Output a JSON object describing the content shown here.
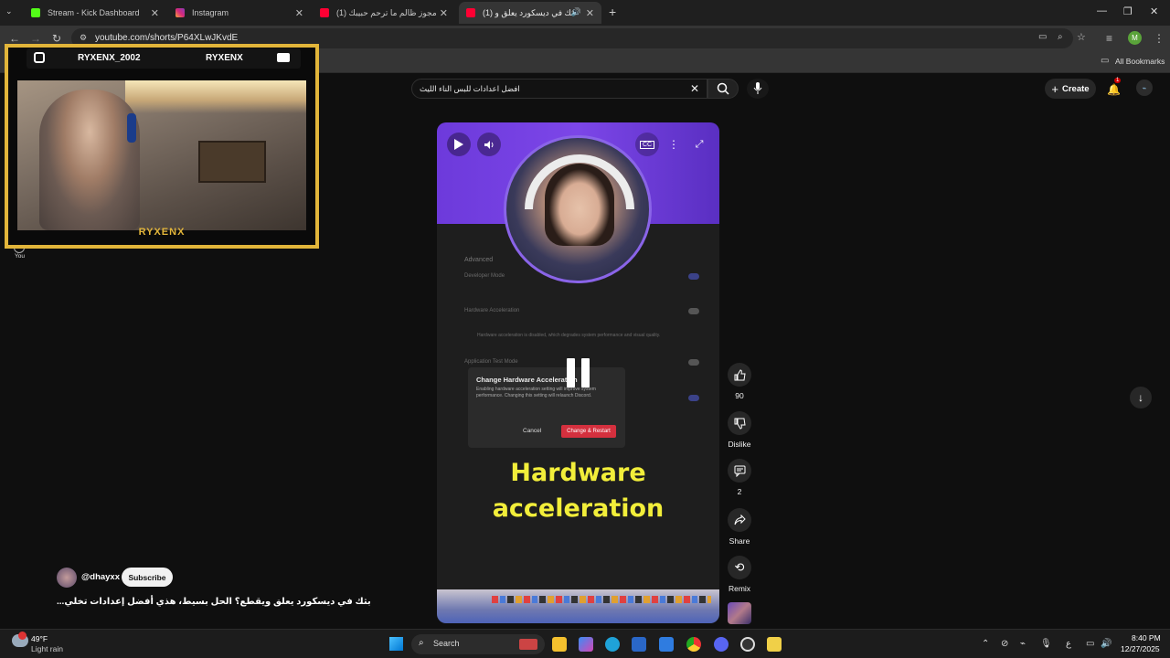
{
  "browser": {
    "tabs": [
      {
        "label": "Stream - Kick Dashboard",
        "active": false
      },
      {
        "label": "Instagram",
        "active": false
      },
      {
        "label": "(1) مجوز ظالم ما ترحم حبيبك / ...",
        "active": false
      },
      {
        "label": "(1) بثك في ديسكورد يعلق و...",
        "active": true
      }
    ],
    "url": "youtube.com/shorts/P64XLwJKvdE",
    "bookmarks_label": "All Bookmarks",
    "profile_initial": "M"
  },
  "youtube": {
    "search_value": "افضل اعدادات للبس الناء الليث",
    "create_label": "Create",
    "notification_count": "1"
  },
  "webcam_overlay": {
    "handle_left": "RYXENX_2002",
    "handle_right": "RYXENX",
    "name": "RYXENX"
  },
  "sidebar": {
    "you_label": "You"
  },
  "short": {
    "settings_heading": "Advanced",
    "settings_items": [
      "Developer Mode",
      "Hardware Acceleration",
      "Application Test Mode"
    ],
    "warning_text": "Hardware acceleration is disabled, which degrades system performance and visual quality.",
    "dialog_title": "Change Hardware Acceleration",
    "dialog_body": "Enabling hardware acceleration setting will improve system performance. Changing this setting will relaunch Discord.",
    "dialog_cancel": "Cancel",
    "dialog_confirm": "Change & Restart",
    "caption_line1": "Hardware",
    "caption_line2": "acceleration"
  },
  "actions": {
    "like_count": "90",
    "dislike_label": "Dislike",
    "comments_count": "2",
    "share_label": "Share",
    "remix_label": "Remix"
  },
  "channel": {
    "handle": "@dhayxx",
    "subscribe_label": "Subscribe",
    "title": "بثك في ديسكورد يعلق ويقطع؟ الحل بسيط، هذي أفضل إعدادات تخلي..."
  },
  "taskbar": {
    "weather_temp": "49°F",
    "weather_desc": "Light rain",
    "search_label": "Search",
    "language": "ع",
    "time": "8:40 PM",
    "date": "12/27/2025"
  },
  "colors": {
    "accent_gold": "#e2b53a",
    "caption_yellow": "#f2ee3a",
    "confirm_red": "#d4303e",
    "purple": "#7c46e8"
  }
}
